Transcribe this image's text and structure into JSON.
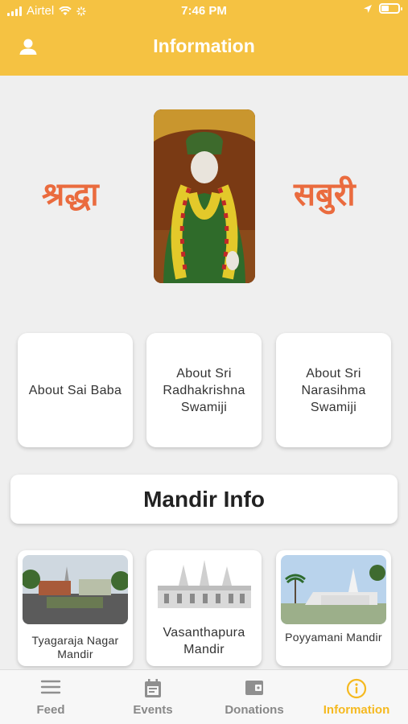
{
  "status_bar": {
    "carrier": "Airtel",
    "time": "7:46 PM"
  },
  "header": {
    "title": "Information"
  },
  "hero": {
    "left_word": "श्रद्धा",
    "right_word": "सबुरी"
  },
  "about_cards": [
    {
      "label": "About Sai Baba"
    },
    {
      "label": "About Sri Radhakrishna Swamiji"
    },
    {
      "label": "About Sri Narasihma Swamiji"
    }
  ],
  "mandir_section": {
    "title": "Mandir Info"
  },
  "mandirs": [
    {
      "name": "Tyagaraja Nagar Mandir"
    },
    {
      "name": "Vasanthapura Mandir"
    },
    {
      "name": "Poyyamani Mandir"
    }
  ],
  "tabs": [
    {
      "label": "Feed",
      "icon": "menu-icon"
    },
    {
      "label": "Events",
      "icon": "calendar-icon"
    },
    {
      "label": "Donations",
      "icon": "wallet-icon"
    },
    {
      "label": "Information",
      "icon": "info-icon",
      "active": true
    }
  ],
  "colors": {
    "accent": "#f5c242",
    "hindi_text": "#ea6b3e",
    "active_tab": "#f5b91f"
  }
}
